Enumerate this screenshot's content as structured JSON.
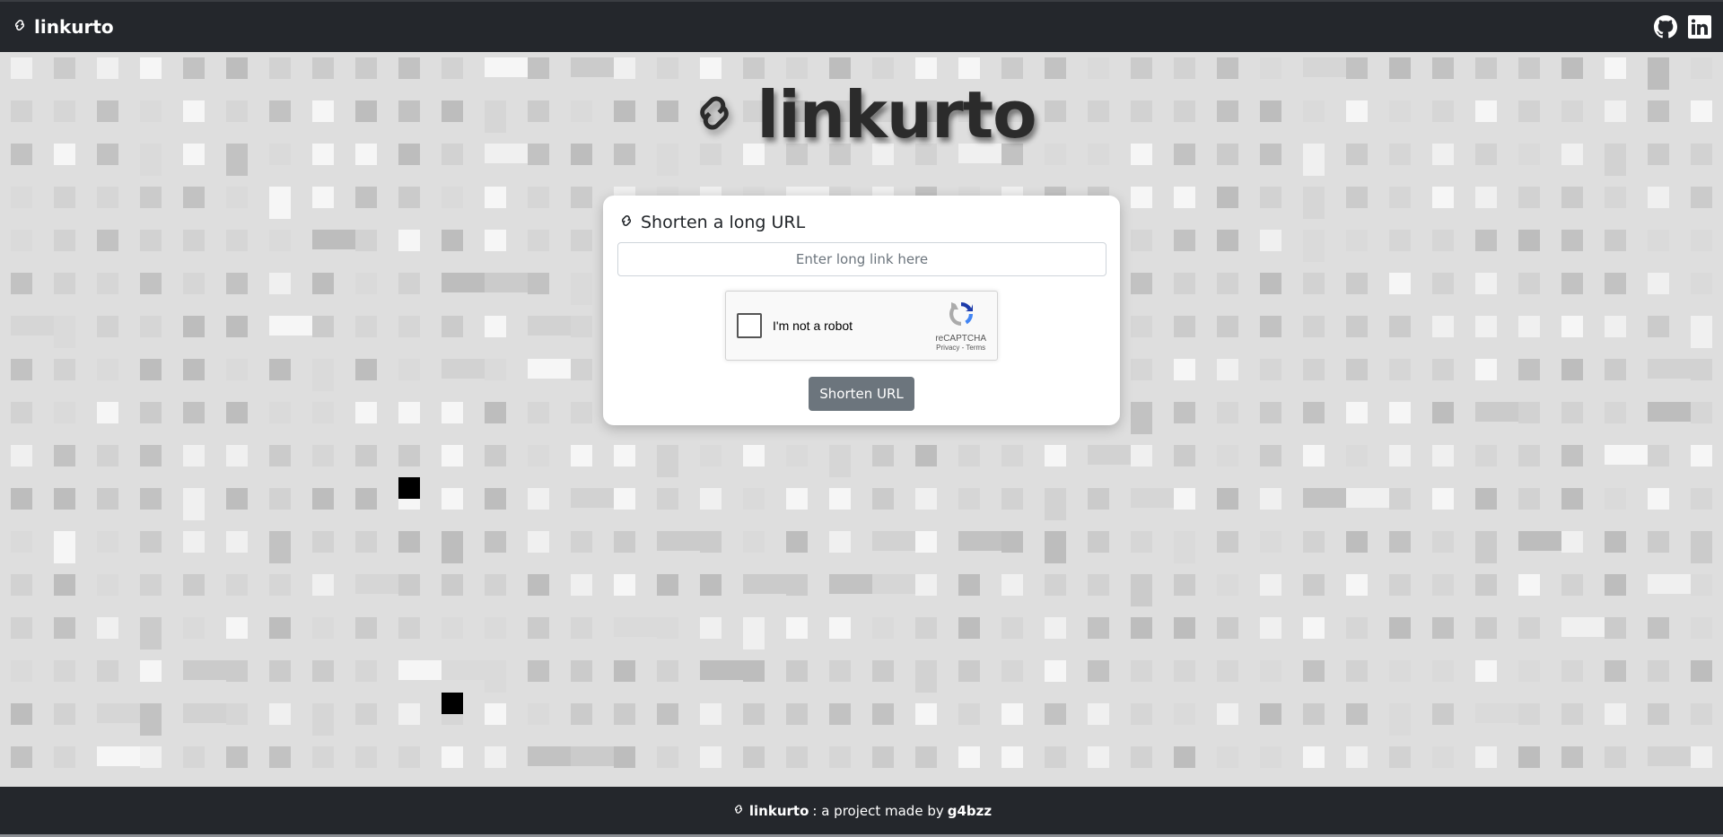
{
  "navbar": {
    "brand_label": "linkurto",
    "icons": [
      "link-icon",
      "github-icon",
      "linkedin-icon"
    ]
  },
  "hero": {
    "title": "linkurto"
  },
  "card": {
    "title": "Shorten a long URL",
    "input_placeholder": "Enter long link here",
    "input_value": "",
    "submit_label": "Shorten URL"
  },
  "captcha": {
    "label": "I'm not a robot",
    "brand": "reCAPTCHA",
    "links": "Privacy - Terms"
  },
  "footer": {
    "project_name": "linkurto",
    "middle_text": ": a project made by",
    "author": "g4bzz"
  },
  "colors": {
    "navbar_bg": "#24272c",
    "page_bg": "#dedede",
    "button_bg": "#6c757d"
  }
}
